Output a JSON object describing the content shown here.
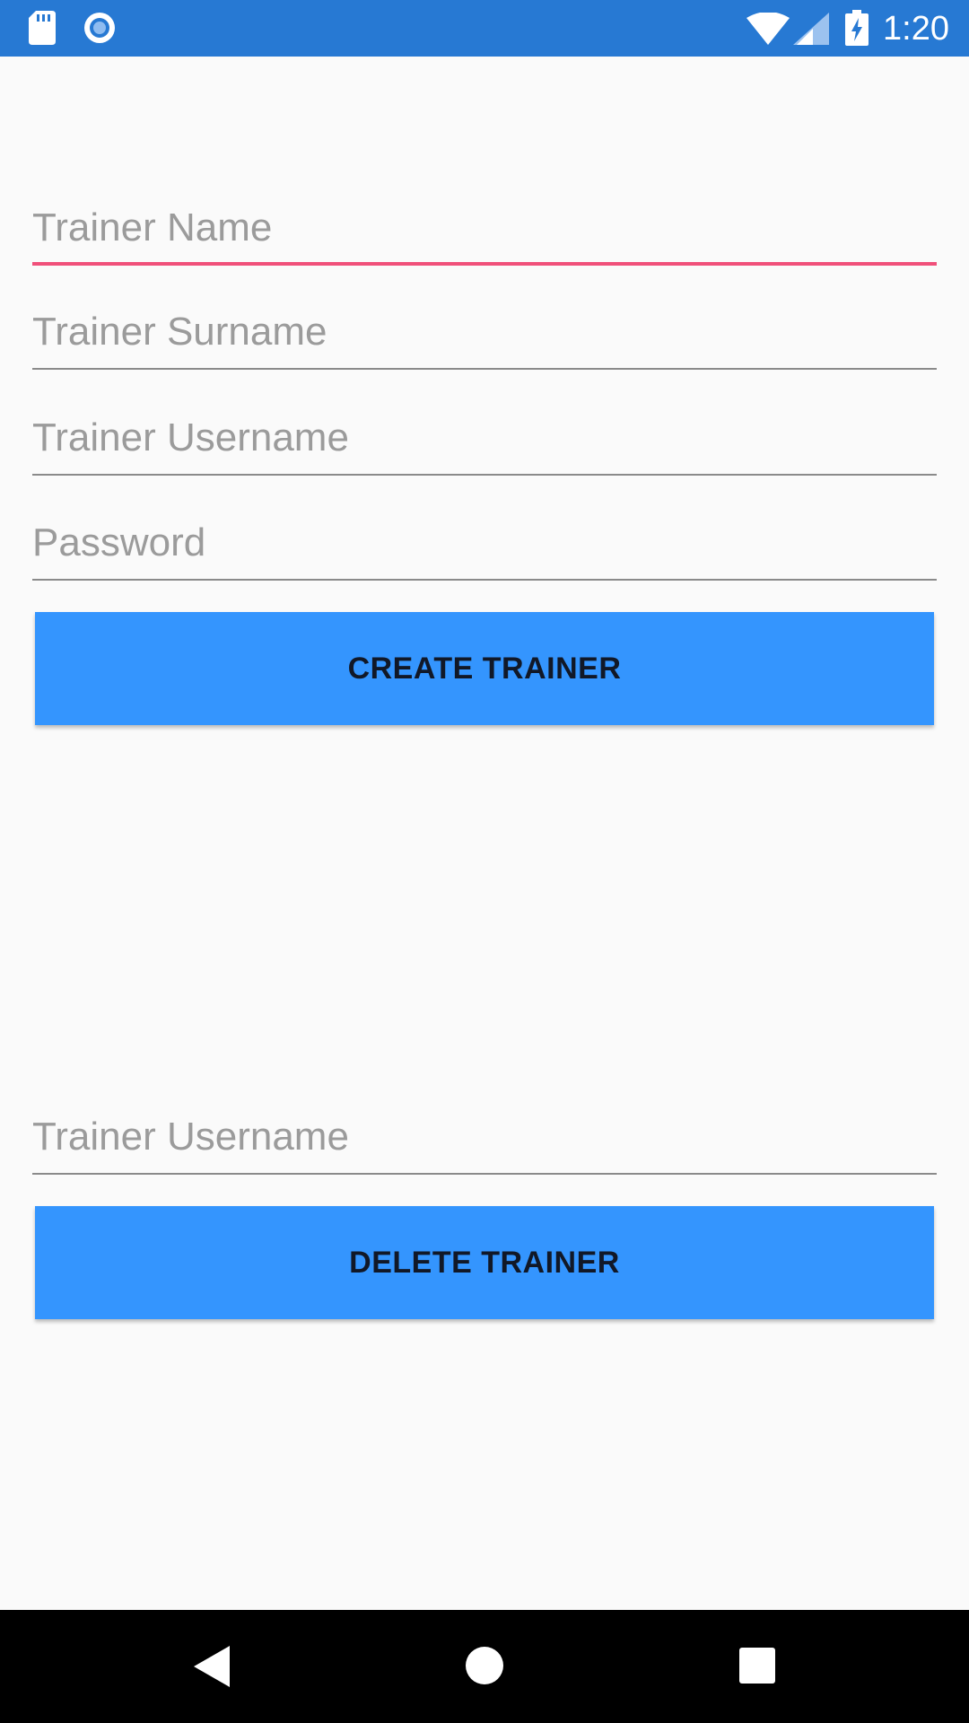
{
  "status_bar": {
    "time": "1:20",
    "background_color": "#2779d3",
    "icons": [
      "sd-card-icon",
      "circle-notification-icon",
      "wifi-icon",
      "signal-icon",
      "battery-charging-icon"
    ]
  },
  "create_form": {
    "trainer_name": {
      "value": "",
      "placeholder": "Trainer Name",
      "focused": true
    },
    "trainer_surname": {
      "value": "",
      "placeholder": "Trainer Surname"
    },
    "trainer_username": {
      "value": "",
      "placeholder": "Trainer Username"
    },
    "password": {
      "value": "",
      "placeholder": "Password"
    },
    "submit_label": "CREATE TRAINER"
  },
  "delete_form": {
    "trainer_username": {
      "value": "",
      "placeholder": "Trainer Username"
    },
    "submit_label": "DELETE TRAINER"
  },
  "colors": {
    "button_background": "#3495fe",
    "focus_accent": "#f0507a",
    "page_background": "#fafafa"
  },
  "nav_bar": {
    "icons": [
      "back-icon",
      "home-icon",
      "recents-icon"
    ]
  }
}
